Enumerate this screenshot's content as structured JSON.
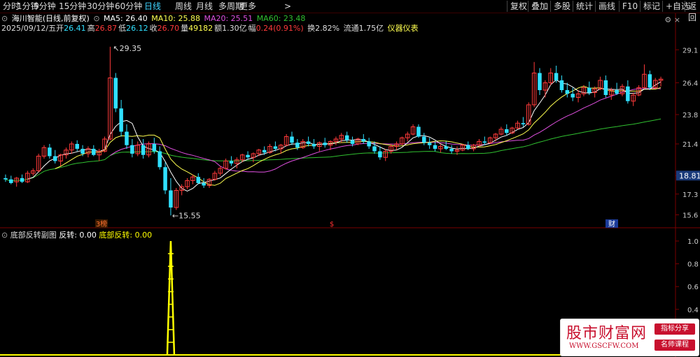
{
  "toolbar": {
    "periods": [
      "分时",
      "1分钟",
      "5分钟",
      "15分钟",
      "30分钟",
      "60分钟",
      "日线",
      "周线",
      "月线",
      "多周期",
      "更多"
    ],
    "active_period": "日线",
    "more_arrow": ">",
    "right_buttons": [
      "复权",
      "叠加",
      "多股",
      "统计",
      "画线",
      "F10",
      "标记",
      "+自选",
      "返回"
    ]
  },
  "info": {
    "stock": "海川智能(日线,前复权)",
    "ma5": "MA5: 26.40",
    "ma10": "MA10: 25.88",
    "ma20": "MA20: 25.51",
    "ma60": "MA60: 23.48",
    "date": "2025/09/12/五",
    "open_label": "开",
    "open": "26.41",
    "high_label": "高",
    "high": "26.87",
    "low_label": "低",
    "low": "26.12",
    "close_label": "收",
    "close": "26.70",
    "vol_label": "量",
    "volume": "49182",
    "amount_label": "额",
    "amount": "1.30亿",
    "change_label": "幅",
    "change": "0.24(0.91%)",
    "turnover": "换2.82%",
    "float_shares": "流通1.75亿",
    "gauge": "仪器仪表"
  },
  "subchart": {
    "indicator_name": "底部反转副图",
    "value1_label": "反转: 0.00",
    "value2_label": "底部反转: 0.00"
  },
  "colors": {
    "up": "#ff3a3a",
    "down": "#30e0ff",
    "ma5": "#ffffff",
    "ma10": "#ffff50",
    "ma20": "#e050e0",
    "ma60": "#30c030",
    "signal": "#ffff00"
  },
  "chart_data": {
    "type": "candlestick",
    "y_axis_ticks": [
      "29.1",
      "26.4",
      "23.8",
      "21.4",
      "18.81",
      "17.3",
      "15.6"
    ],
    "current_price_tag": "18.81",
    "annotations": {
      "high_label": "29.35",
      "low_label": "15.55",
      "low_arrow": "←"
    },
    "event_markers": [
      "3榜",
      "$",
      "财"
    ],
    "sub_y_axis_ticks": [
      "1.0",
      "0.8",
      "0.6",
      "0.4",
      "0.2"
    ],
    "candles": [
      [
        18.6,
        18.9,
        18.3,
        18.5
      ],
      [
        18.5,
        18.8,
        18.1,
        18.2
      ],
      [
        18.3,
        18.7,
        17.9,
        18.6
      ],
      [
        18.6,
        18.9,
        18.2,
        18.3
      ],
      [
        18.3,
        19.2,
        18.2,
        19.0
      ],
      [
        19.0,
        19.4,
        18.8,
        19.2
      ],
      [
        19.2,
        20.6,
        19.1,
        20.4
      ],
      [
        20.4,
        21.3,
        20.2,
        21.1
      ],
      [
        21.1,
        21.4,
        20.2,
        20.4
      ],
      [
        20.4,
        20.9,
        19.8,
        20.0
      ],
      [
        20.0,
        20.6,
        19.6,
        20.5
      ],
      [
        20.5,
        21.1,
        20.2,
        20.9
      ],
      [
        20.9,
        21.6,
        20.6,
        21.4
      ],
      [
        21.4,
        21.7,
        20.8,
        21.0
      ],
      [
        21.0,
        21.3,
        20.4,
        20.6
      ],
      [
        20.6,
        21.2,
        20.3,
        21.0
      ],
      [
        21.0,
        21.3,
        20.4,
        20.5
      ],
      [
        20.5,
        21.0,
        20.0,
        20.8
      ],
      [
        20.8,
        22.0,
        20.7,
        21.8
      ],
      [
        21.8,
        29.35,
        21.7,
        26.8
      ],
      [
        26.8,
        27.2,
        24.0,
        24.3
      ],
      [
        24.3,
        25.0,
        22.0,
        22.4
      ],
      [
        22.4,
        23.0,
        21.0,
        21.3
      ],
      [
        21.3,
        21.8,
        20.3,
        20.6
      ],
      [
        20.6,
        21.6,
        20.4,
        21.3
      ],
      [
        21.3,
        21.8,
        20.2,
        20.5
      ],
      [
        20.5,
        21.6,
        20.3,
        21.4
      ],
      [
        21.4,
        21.9,
        20.6,
        20.8
      ],
      [
        20.8,
        21.2,
        19.3,
        19.5
      ],
      [
        19.5,
        19.9,
        17.3,
        17.6
      ],
      [
        17.6,
        18.6,
        15.55,
        16.2
      ],
      [
        16.2,
        17.8,
        16.0,
        17.6
      ],
      [
        17.6,
        18.1,
        17.2,
        17.9
      ],
      [
        17.9,
        18.6,
        17.7,
        18.4
      ],
      [
        18.4,
        18.9,
        18.1,
        18.7
      ],
      [
        18.7,
        19.0,
        18.1,
        18.2
      ],
      [
        18.2,
        18.6,
        17.8,
        18.0
      ],
      [
        18.0,
        18.6,
        17.8,
        18.5
      ],
      [
        18.5,
        19.2,
        18.4,
        19.0
      ],
      [
        19.0,
        19.6,
        18.8,
        19.4
      ],
      [
        19.4,
        20.2,
        19.3,
        20.0
      ],
      [
        20.0,
        20.4,
        19.6,
        19.8
      ],
      [
        19.8,
        20.3,
        19.4,
        20.1
      ],
      [
        20.1,
        20.6,
        19.9,
        20.5
      ],
      [
        20.5,
        20.8,
        20.1,
        20.3
      ],
      [
        20.3,
        20.7,
        19.9,
        20.6
      ],
      [
        20.6,
        21.0,
        20.4,
        20.9
      ],
      [
        20.9,
        21.2,
        20.5,
        20.7
      ],
      [
        20.7,
        21.4,
        20.6,
        21.2
      ],
      [
        21.2,
        21.6,
        20.8,
        21.0
      ],
      [
        21.0,
        21.4,
        20.6,
        21.3
      ],
      [
        21.3,
        22.2,
        21.2,
        22.0
      ],
      [
        22.0,
        22.4,
        21.3,
        21.5
      ],
      [
        21.5,
        21.8,
        20.9,
        21.1
      ],
      [
        21.1,
        21.8,
        21.0,
        21.6
      ],
      [
        21.6,
        22.0,
        21.2,
        21.4
      ],
      [
        21.4,
        21.8,
        21.0,
        21.2
      ],
      [
        21.2,
        21.6,
        20.8,
        21.5
      ],
      [
        21.5,
        21.9,
        21.1,
        21.3
      ],
      [
        21.3,
        21.7,
        20.9,
        21.6
      ],
      [
        21.6,
        22.0,
        21.3,
        21.8
      ],
      [
        21.8,
        22.3,
        21.5,
        22.1
      ],
      [
        22.1,
        22.4,
        21.5,
        21.7
      ],
      [
        21.7,
        22.0,
        21.2,
        21.4
      ],
      [
        21.4,
        21.9,
        21.3,
        21.8
      ],
      [
        21.8,
        22.2,
        21.4,
        21.6
      ],
      [
        21.6,
        21.9,
        21.0,
        21.2
      ],
      [
        21.2,
        21.6,
        20.6,
        20.8
      ],
      [
        20.8,
        21.2,
        20.1,
        20.3
      ],
      [
        20.3,
        21.0,
        20.0,
        20.8
      ],
      [
        20.8,
        21.4,
        20.6,
        21.2
      ],
      [
        21.2,
        21.6,
        20.9,
        21.4
      ],
      [
        21.4,
        22.0,
        21.3,
        21.9
      ],
      [
        21.9,
        22.4,
        21.6,
        22.2
      ],
      [
        22.2,
        23.0,
        22.1,
        22.8
      ],
      [
        22.8,
        23.0,
        21.9,
        22.0
      ],
      [
        22.0,
        22.3,
        21.3,
        21.5
      ],
      [
        21.5,
        21.9,
        21.0,
        21.3
      ],
      [
        21.3,
        21.6,
        20.8,
        21.0
      ],
      [
        21.0,
        21.4,
        20.7,
        21.2
      ],
      [
        21.2,
        21.6,
        20.9,
        21.0
      ],
      [
        21.0,
        21.3,
        20.6,
        20.8
      ],
      [
        20.8,
        21.2,
        20.5,
        20.9
      ],
      [
        20.9,
        21.4,
        20.8,
        21.3
      ],
      [
        21.3,
        21.6,
        20.9,
        21.0
      ],
      [
        21.0,
        21.4,
        20.8,
        21.3
      ],
      [
        21.3,
        21.8,
        21.2,
        21.6
      ],
      [
        21.6,
        22.0,
        21.3,
        21.5
      ],
      [
        21.5,
        22.0,
        21.4,
        21.9
      ],
      [
        21.9,
        22.3,
        21.6,
        22.2
      ],
      [
        22.2,
        22.8,
        22.1,
        22.6
      ],
      [
        22.6,
        23.0,
        22.1,
        22.3
      ],
      [
        22.3,
        22.8,
        22.2,
        22.7
      ],
      [
        22.7,
        23.3,
        22.6,
        23.1
      ],
      [
        23.1,
        23.6,
        22.8,
        23.0
      ],
      [
        23.0,
        24.8,
        22.9,
        24.6
      ],
      [
        24.6,
        28.1,
        24.4,
        27.2
      ],
      [
        27.2,
        27.6,
        25.4,
        25.8
      ],
      [
        25.8,
        26.6,
        25.2,
        26.4
      ],
      [
        26.4,
        27.6,
        26.2,
        27.2
      ],
      [
        27.2,
        27.8,
        26.4,
        26.6
      ],
      [
        26.6,
        27.0,
        25.6,
        25.8
      ],
      [
        25.8,
        26.4,
        25.2,
        25.5
      ],
      [
        25.5,
        26.0,
        24.9,
        25.2
      ],
      [
        25.2,
        25.8,
        24.8,
        25.5
      ],
      [
        25.5,
        26.2,
        25.3,
        26.0
      ],
      [
        26.0,
        26.5,
        25.4,
        25.6
      ],
      [
        25.6,
        26.1,
        25.2,
        25.9
      ],
      [
        25.9,
        26.9,
        25.8,
        26.6
      ],
      [
        26.6,
        27.0,
        25.2,
        25.4
      ],
      [
        25.4,
        26.0,
        25.0,
        25.8
      ],
      [
        25.8,
        26.4,
        25.4,
        25.5
      ],
      [
        25.5,
        26.3,
        25.3,
        26.1
      ],
      [
        26.1,
        26.6,
        24.7,
        24.9
      ],
      [
        24.9,
        25.6,
        24.5,
        25.4
      ],
      [
        25.4,
        26.2,
        25.3,
        26.0
      ],
      [
        26.0,
        27.9,
        25.9,
        27.1
      ],
      [
        27.1,
        27.4,
        25.8,
        26.0
      ],
      [
        26.0,
        26.8,
        25.9,
        26.6
      ],
      [
        26.6,
        26.9,
        26.1,
        26.7
      ]
    ]
  }
}
